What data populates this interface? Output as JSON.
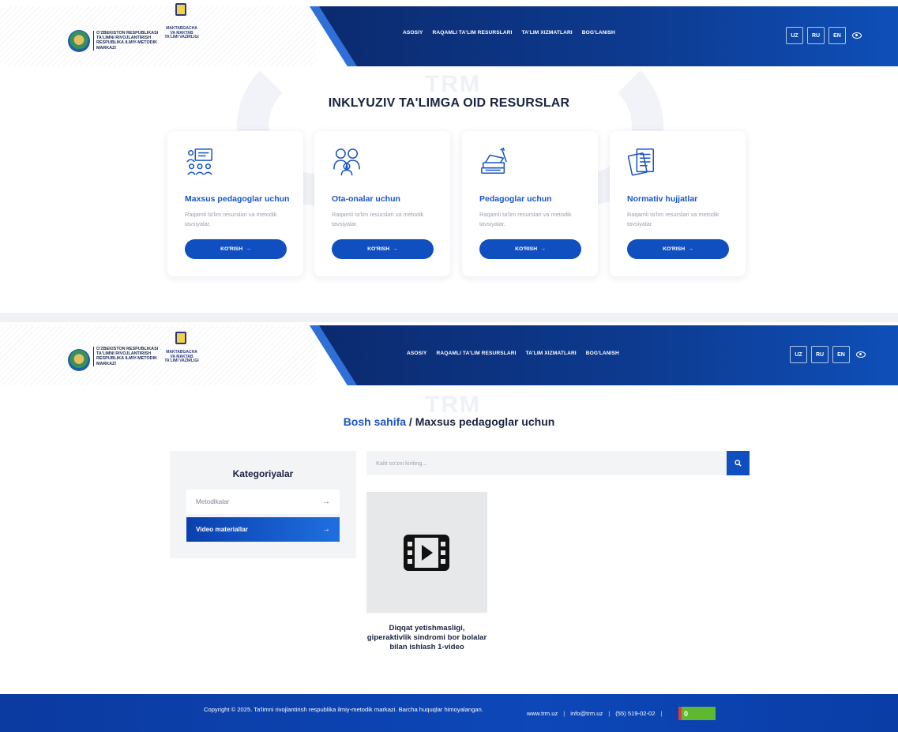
{
  "header": {
    "org_lines": [
      "O'ZBEKISTON RESPUBLIKASI",
      "TA'LIMNI RIVOJLANTIRISH",
      "RESPUBLIKA ILMIY-METODIK",
      "MARKAZI"
    ],
    "ministry_lines": [
      "MAKTABGACHA",
      "VA MAKTAB",
      "TA'LIMI VAZIRLIGI"
    ],
    "nav": [
      "ASOSIY",
      "RAQAMLI TA'LIM RESURSLARI",
      "TA'LIM XIZMATLARI",
      "BOG'LANISH"
    ],
    "languages": [
      "UZ",
      "RU",
      "EN"
    ],
    "watermark": "TRM"
  },
  "section1": {
    "title": "INKLYUZIV TA'LIMGA OID RESURSLAR",
    "cards": [
      {
        "title": "Maxsus pedagoglar uchun",
        "description": "Raqamli ta'lim resurslari va metodik tavsiyalar.",
        "button": "KO'RISH",
        "icon": "teacher-board-icon"
      },
      {
        "title": "Ota-onalar uchun",
        "description": "Raqamli ta'lim resurslari va metodik tavsiyalar.",
        "button": "KO'RISH",
        "icon": "parents-icon"
      },
      {
        "title": "Pedagoglar uchun",
        "description": "Raqamli ta'lim resurslari va metodik tavsiyalar.",
        "button": "KO'RISH",
        "icon": "books-pen-icon"
      },
      {
        "title": "Normativ hujjatlar",
        "description": "Raqamli ta'lim resurslari va metodik tavsiyalar.",
        "button": "KO'RISH",
        "icon": "documents-icon"
      }
    ]
  },
  "section2": {
    "breadcrumb_home": "Bosh sahifa",
    "breadcrumb_sep": " / ",
    "breadcrumb_current": "Maxsus pedagoglar uchun",
    "categories_title": "Kategoriyalar",
    "categories": [
      {
        "label": "Metodikalar",
        "active": false
      },
      {
        "label": "Video materiallar",
        "active": true
      }
    ],
    "search_placeholder": "Kalit so'zni kiriting...",
    "video_title": "Diqqat yetishmasligi, giperaktivlik sindromi bor bolalar bilan ishlash 1-video"
  },
  "footer": {
    "copyright": "Copyright © 2025. Ta'limni rivojlantirish respublika ilmiy-metodik markazi. Barcha huquqlar himoyalangan.",
    "website": "www.trm.uz",
    "email": "info@trm.uz",
    "phone": "(55) 519-02-02",
    "separator": "|",
    "counter_value": "0"
  },
  "colors": {
    "primary": "#0f4fc0",
    "accent_title": "#1a55c4",
    "header_dark": "#0b2a6e",
    "footer": "#0d47b8",
    "counter_green": "#5fb832"
  }
}
